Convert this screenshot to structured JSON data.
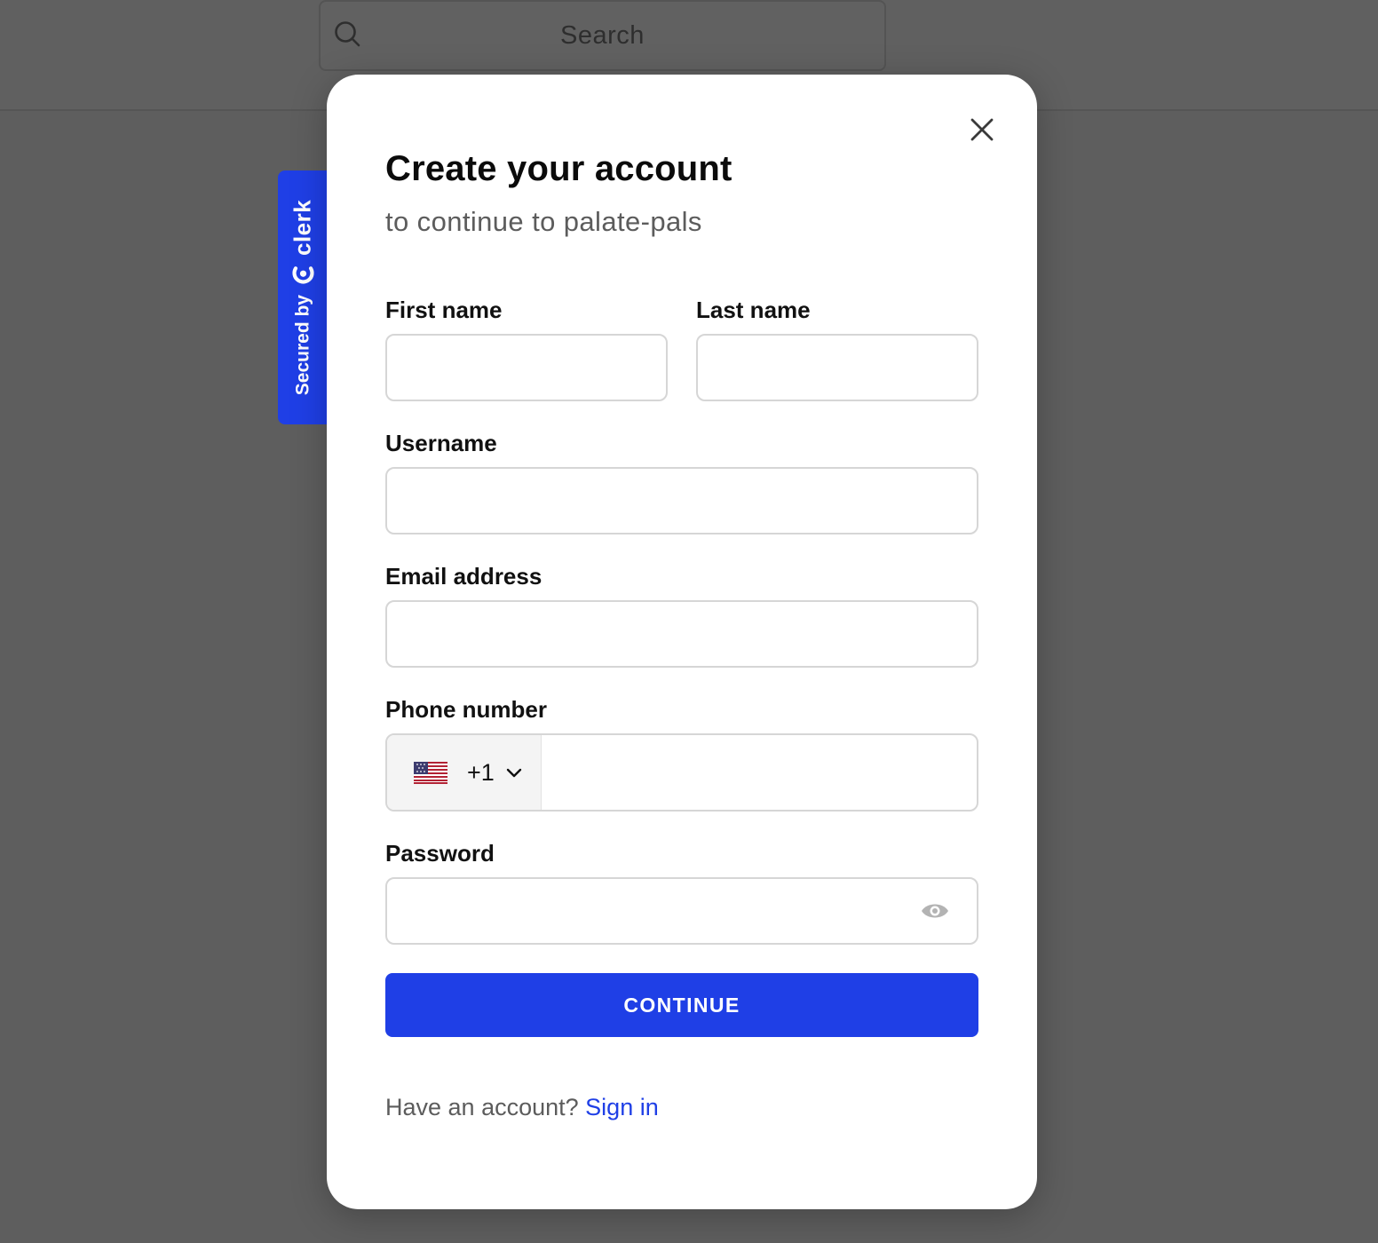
{
  "search": {
    "placeholder": "Search",
    "icon": "search-icon"
  },
  "badge": {
    "secured_by": "Secured by",
    "brand": "clerk",
    "color": "#1f3fe6"
  },
  "modal": {
    "title": "Create your account",
    "subtitle": "to continue to palate-pals",
    "close_icon": "close-icon",
    "fields": {
      "first_name": {
        "label": "First name",
        "value": ""
      },
      "last_name": {
        "label": "Last name",
        "value": ""
      },
      "username": {
        "label": "Username",
        "value": ""
      },
      "email": {
        "label": "Email address",
        "value": ""
      },
      "phone": {
        "label": "Phone number",
        "country_flag": "us-flag-icon",
        "dial_code": "+1",
        "value": ""
      },
      "password": {
        "label": "Password",
        "value": "",
        "toggle_icon": "eye-icon"
      }
    },
    "continue_label": "CONTINUE",
    "footer": {
      "prompt": "Have an account?",
      "link": "Sign in"
    }
  },
  "colors": {
    "accent": "#1f3fe6",
    "overlay": "#5e5e5e"
  }
}
